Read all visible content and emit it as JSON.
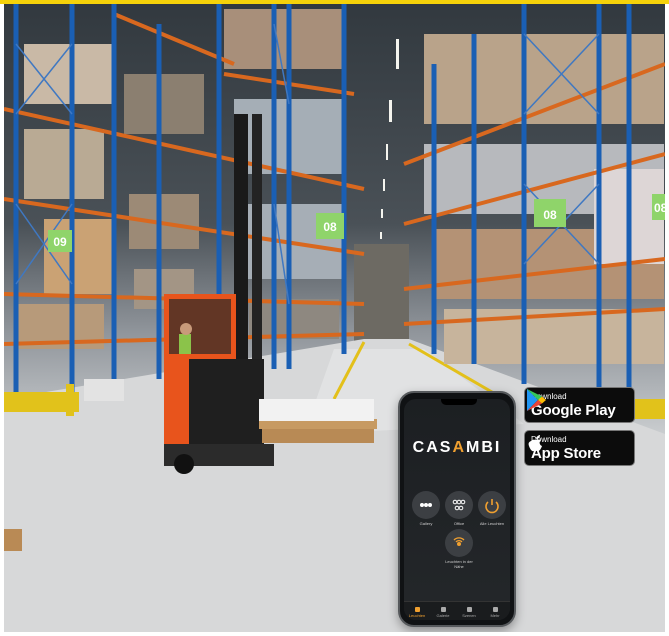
{
  "scene": {
    "aisle_signs": [
      "09",
      "08",
      "08",
      "08"
    ],
    "colors": {
      "rack_blue": "#1a5fb4",
      "beam_orange": "#d8681f",
      "forklift_orange": "#e8541c",
      "sign_green": "#8fd46a"
    }
  },
  "badges": {
    "google_play": {
      "small": "Download",
      "big": "Google Play"
    },
    "app_store": {
      "small": "Download",
      "big": "App Store"
    }
  },
  "phone": {
    "brand_left": "CAS",
    "brand_accent": "A",
    "brand_right": "MBI",
    "apps": [
      {
        "label": "Gallery",
        "icon": "gallery-icon"
      },
      {
        "label": "Office",
        "icon": "office-icon"
      },
      {
        "label": "Alle Leuchten",
        "icon": "power-icon"
      },
      {
        "label": "Leuchten in der Nähe",
        "icon": "nearby-icon"
      }
    ],
    "tabs": [
      {
        "label": "Leuchten",
        "icon": "lamp-icon"
      },
      {
        "label": "Galerie",
        "icon": "gallery-icon"
      },
      {
        "label": "Szenen",
        "icon": "scenes-icon"
      },
      {
        "label": "Mehr",
        "icon": "more-icon"
      }
    ]
  }
}
